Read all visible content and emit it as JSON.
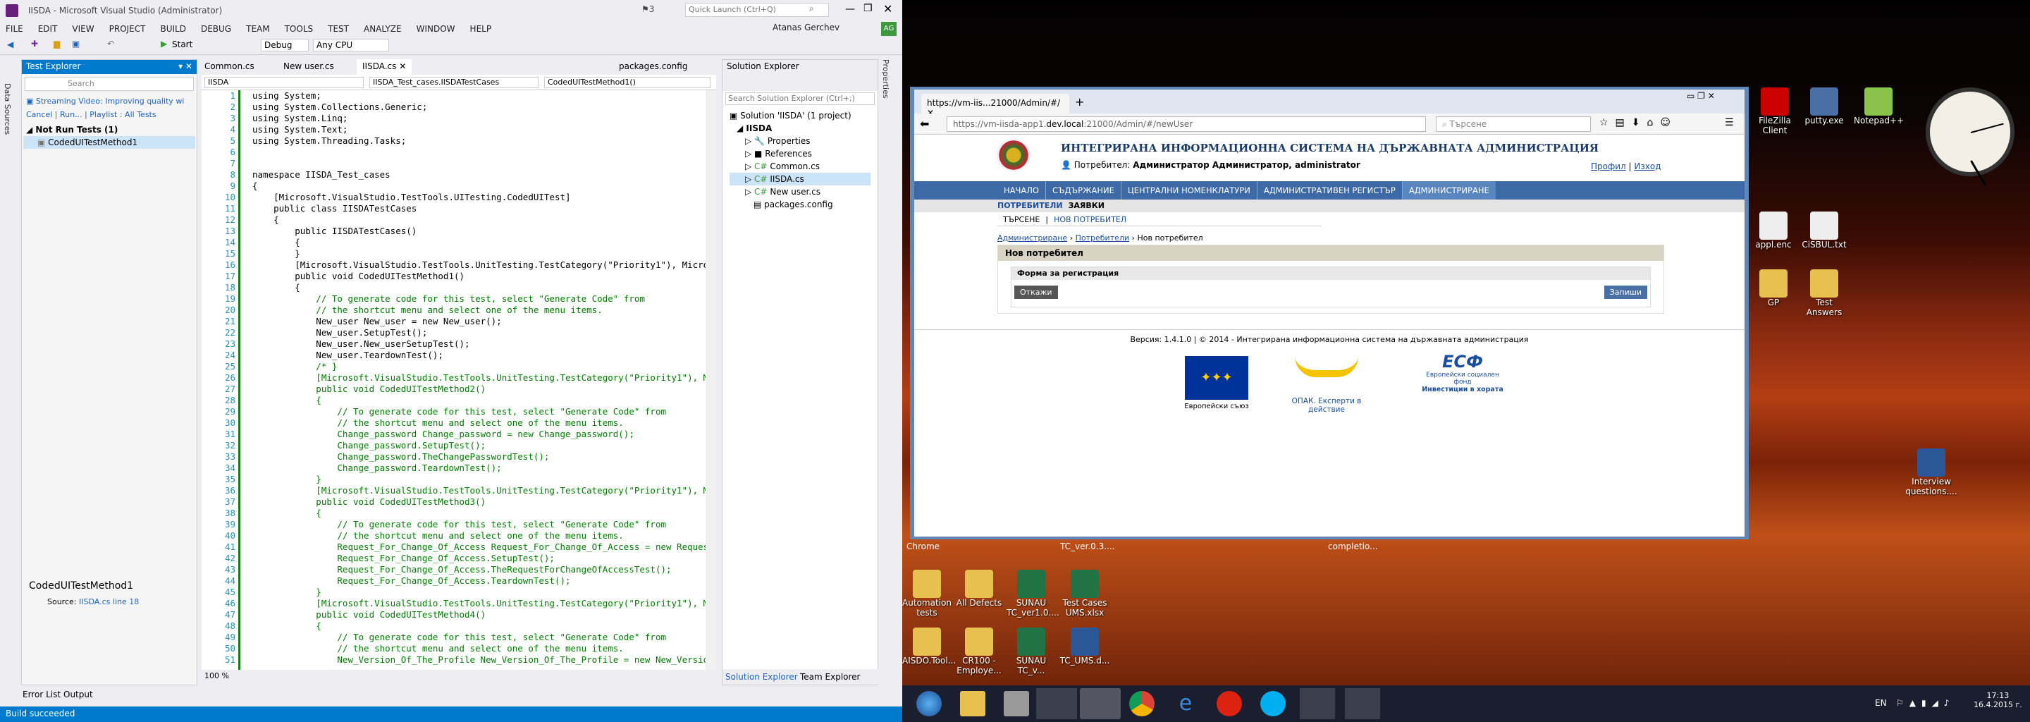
{
  "vs": {
    "title": "IISDA - Microsoft Visual Studio (Administrator)",
    "notif_count": "3",
    "quick_launch_placeholder": "Quick Launch (Ctrl+Q)",
    "user": "Atanas Gerchev",
    "user_initials": "AG",
    "menu": [
      "FILE",
      "EDIT",
      "VIEW",
      "PROJECT",
      "BUILD",
      "DEBUG",
      "TEAM",
      "TOOLS",
      "TEST",
      "ANALYZE",
      "WINDOW",
      "HELP"
    ],
    "toolbar": {
      "start": "Start",
      "config": "Debug",
      "platform": "Any CPU"
    },
    "side_tabs": [
      "Data Sources"
    ],
    "right_side_tab": "Properties",
    "test_explorer": {
      "title": "Test Explorer",
      "search_placeholder": "Search",
      "streaming": "Streaming Video: Improving quality wi",
      "cancel": "Cancel",
      "run": "Run...",
      "playlist": "Playlist : All Tests",
      "group": "Not Run Tests (1)",
      "item": "CodedUITestMethod1",
      "detail_title": "CodedUITestMethod1",
      "source_label": "Source:",
      "source_link": "IISDA.cs line 18"
    },
    "tabs": [
      "Common.cs",
      "New user.cs",
      "IISDA.cs",
      "packages.config"
    ],
    "nav": [
      "IISDA",
      "IISDA_Test_cases.IISDATestCases",
      "CodedUITestMethod1()"
    ],
    "zoom": "100 %",
    "bottom_tabs": [
      "Error List",
      "Output"
    ],
    "status": "Build succeeded",
    "solution": {
      "title": "Solution Explorer",
      "search_placeholder": "Search Solution Explorer (Ctrl+;)",
      "root": "Solution 'IISDA' (1 project)",
      "project": "IISDA",
      "items": [
        "Properties",
        "References",
        "Common.cs",
        "IISDA.cs",
        "New user.cs",
        "packages.config"
      ],
      "tabs": [
        "Solution Explorer",
        "Team Explorer"
      ]
    },
    "line_numbers": [
      "1",
      "2",
      "3",
      "4",
      "5",
      "6",
      "7",
      "8",
      "9",
      "10",
      "11",
      "12",
      "13",
      "14",
      "15",
      "16",
      "17",
      "18",
      "19",
      "20",
      "21",
      "22",
      "23",
      "24",
      "25",
      "26",
      "27",
      "28",
      "29",
      "30",
      "31",
      "32",
      "33",
      "34",
      "35",
      "36",
      "37",
      "38",
      "39",
      "40",
      "41",
      "42",
      "43",
      "44",
      "45",
      "46",
      "47",
      "48",
      "49",
      "50",
      "51"
    ],
    "code": [
      "using System;",
      "using System.Collections.Generic;",
      "using System.Linq;",
      "using System.Text;",
      "using System.Threading.Tasks;",
      "",
      "",
      "namespace IISDA_Test_cases",
      "{",
      "    [Microsoft.VisualStudio.TestTools.UITesting.CodedUITest]",
      "    public class IISDATestCases",
      "    {",
      "        public IISDATestCases()",
      "        {",
      "        }",
      "        [Microsoft.VisualStudio.TestTools.UnitTesting.TestCategory(\"Priority1\"), Microsoft.V",
      "        public void CodedUITestMethod1()",
      "        {",
      "            // To generate code for this test, select \"Generate Code\" from",
      "            // the shortcut menu and select one of the menu items.",
      "            New_user New_user = new New_user();",
      "            New_user.SetupTest();",
      "            New_user.New_userSetupTest();",
      "            New_user.TeardownTest();",
      "            /* }",
      "            [Microsoft.VisualStudio.TestTools.UnitTesting.TestCategory(\"Priority1\"), Micros",
      "            public void CodedUITestMethod2()",
      "            {",
      "                // To generate code for this test, select \"Generate Code\" from",
      "                // the shortcut menu and select one of the menu items.",
      "                Change_password Change_password = new Change_password();",
      "                Change_password.SetupTest();",
      "                Change_password.TheChangePasswordTest();",
      "                Change_password.TeardownTest();",
      "            }",
      "            [Microsoft.VisualStudio.TestTools.UnitTesting.TestCategory(\"Priority1\"), Micros",
      "            public void CodedUITestMethod3()",
      "            {",
      "                // To generate code for this test, select \"Generate Code\" from",
      "                // the shortcut menu and select one of the menu items.",
      "                Request_For_Change_Of_Access Request_For_Change_Of_Access = new Request_For",
      "                Request_For_Change_Of_Access.SetupTest();",
      "                Request_For_Change_Of_Access.TheRequestForChangeOfAccessTest();",
      "                Request_For_Change_Of_Access.TeardownTest();",
      "            }",
      "            [Microsoft.VisualStudio.TestTools.UnitTesting.TestCategory(\"Priority1\"), Micros",
      "            public void CodedUITestMethod4()",
      "            {",
      "                // To generate code for this test, select \"Generate Code\" from",
      "                // the shortcut menu and select one of the menu items.",
      "                New_Version_Of_The_Profile New_Version_Of_The_Profile = new New_Version_Of_"
    ]
  },
  "browser": {
    "tab_title": "https://vm-iis...21000/Admin/#/",
    "url_prefix": "https://vm-iisda-app1.",
    "url_host": "dev.local",
    "url_rest": ":21000/Admin/#/newUser",
    "search_placeholder": "Търсене",
    "site_title": "ИНТЕГРИРАНА ИНФОРМАЦИОННА СИСТЕМА НА ДЪРЖАВНАТА АДМИНИСТРАЦИЯ",
    "user_label": "Потребител:",
    "user_value": "Администратор Администратор, administrator",
    "profile": "Профил",
    "logout": "Изход",
    "nav": [
      "НАЧАЛО",
      "СЪДЪРЖАНИЕ",
      "ЦЕНТРАЛНИ НОМЕНКЛАТУРИ",
      "АДМИНИСТРАТИВЕН РЕГИСТЪР",
      "АДМИНИСТРИРАНЕ"
    ],
    "subnav": [
      "ПОТРЕБИТЕЛИ",
      "ЗАЯВКИ"
    ],
    "subsub": [
      "ТЪРСЕНЕ",
      "НОВ ПОТРЕБИТЕЛ"
    ],
    "breadcrumb": [
      "Администриране",
      "Потребители",
      "Нов потребител"
    ],
    "panel_title": "Нов потребител",
    "form_title": "Форма за регистрация",
    "cancel": "Откажи",
    "save": "Запиши",
    "footer": "Версия: 1.4.1.0 | © 2014 - Интегрирана информационна система на държавната администрация",
    "logos": {
      "eu": "Европейски съюз",
      "opak": "ОПАК. Експерти в действие",
      "esf_title": "ЕСФ",
      "esf_sub": "Европейски социален фонд",
      "esf_tag": "Инвестиции в хората"
    }
  },
  "desktop": {
    "icons_right": [
      "FileZilla Client",
      "putty.exe",
      "Notepad++"
    ],
    "icons_right2": [
      "appl.enc",
      "CiSBUL.txt",
      "GP",
      "Test Answers"
    ],
    "icon_doc": "Interview questions....",
    "icons_mid": [
      "Chrome",
      "TC_ver.0.3....",
      "completio..."
    ],
    "icons_bottom": [
      "Automation tests",
      "All Defects",
      "SUNAU TC_ver1.0....",
      "Test Cases UMS.xlsx",
      "AISDO.Tool...",
      "CR100 - Employe...",
      "SUNAU TC_v...",
      "TC_UMS.d..."
    ],
    "lang": "EN",
    "time": "17:13",
    "date": "16.4.2015 г."
  }
}
